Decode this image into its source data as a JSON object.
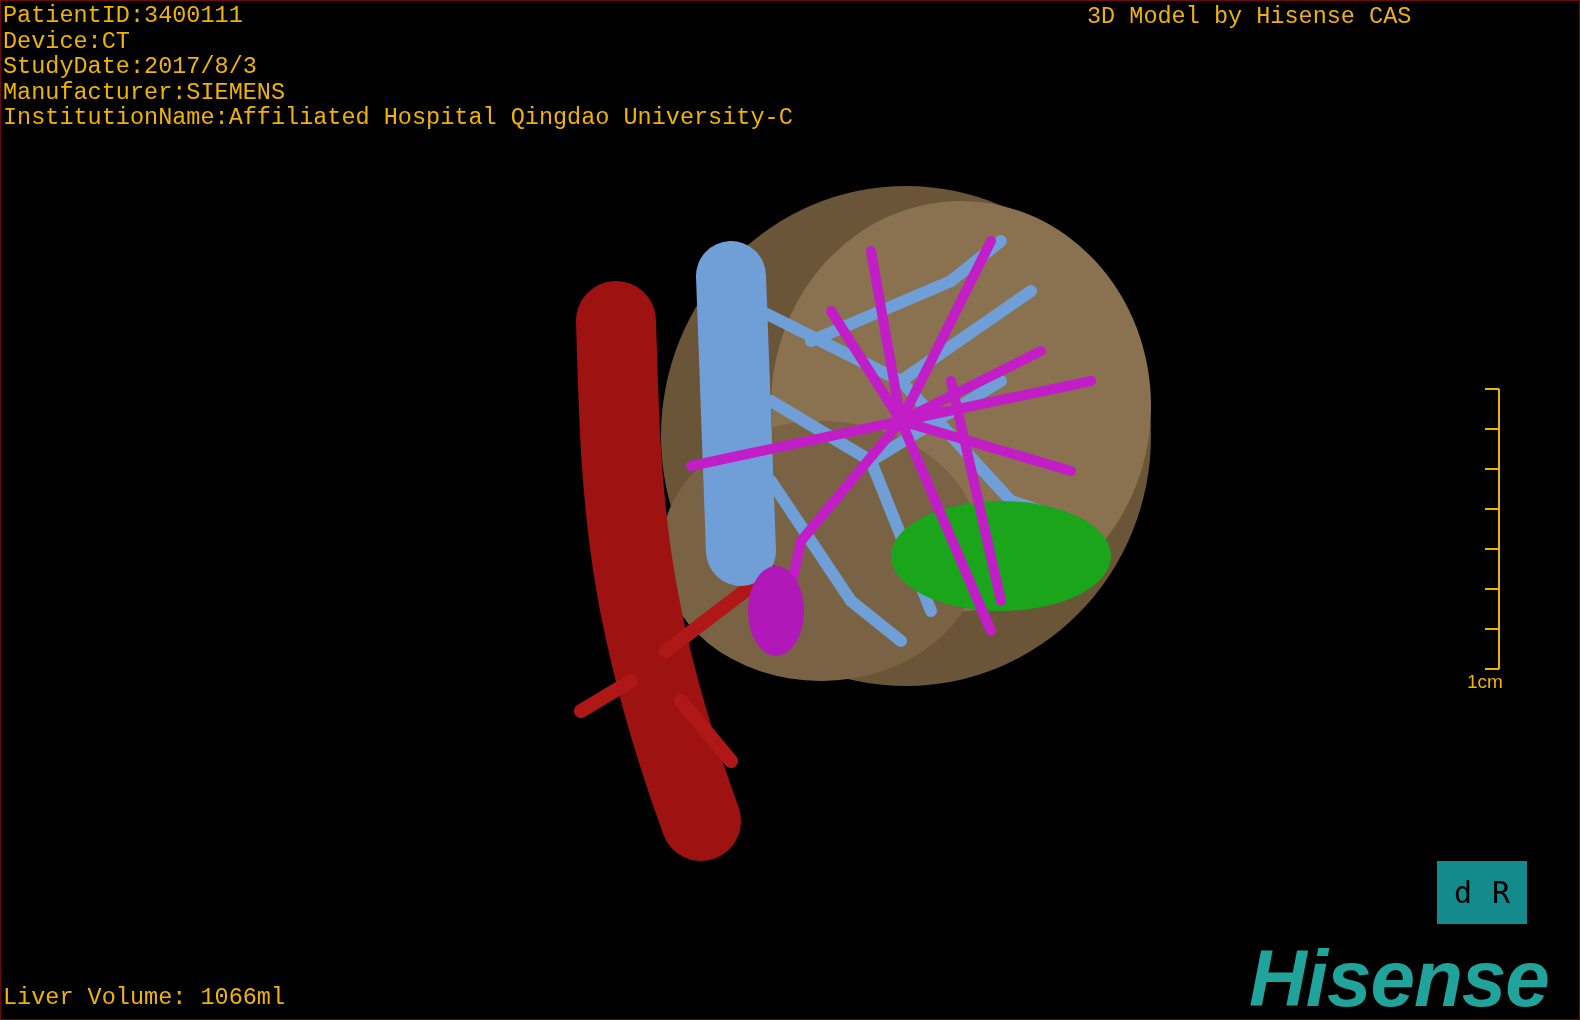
{
  "study_info": [
    "PatientID:3400111",
    "Device:CT",
    "StudyDate:2017/8/3",
    "Manufacturer:SIEMENS",
    "InstitutionName:Affiliated Hospital Qingdao University-C"
  ],
  "model_caption": "3D Model by Hisense CAS",
  "scale_bar": {
    "label": "1cm"
  },
  "orientation_cube": {
    "labels": [
      "d",
      "R"
    ]
  },
  "volume": "Liver Volume: 1066ml",
  "logo": "Hisense"
}
